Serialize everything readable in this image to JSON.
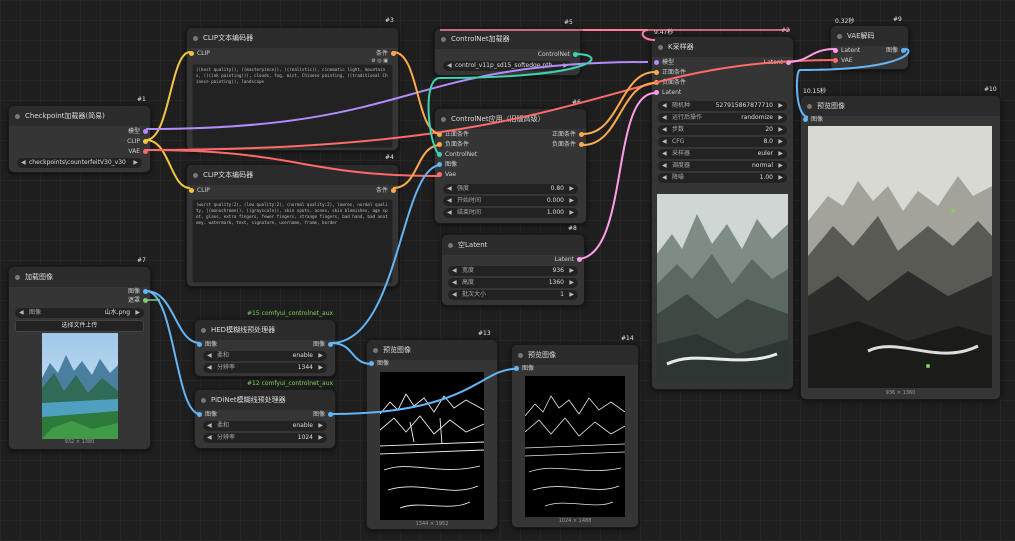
{
  "nodes": {
    "checkpoint": {
      "id": "#1",
      "title": "Checkpoint加载器(简易)",
      "outputs": [
        "模型",
        "CLIP",
        "VAE"
      ],
      "ckpt": "checkpoints\\counterfeitV30_v30"
    },
    "clip_pos": {
      "id": "#3",
      "title": "CLIP文本编码器",
      "input": "CLIP",
      "output": "条件",
      "text": "((best quality)), ((masterpiece)), ((realistic)), cinematic light, mountains, (((ink painting))), clouds, fog, mist, Chinese painting, ((traditional Chinese painting)), landscape"
    },
    "clip_neg": {
      "id": "#4",
      "title": "CLIP文本编码器",
      "input": "CLIP",
      "output": "条件",
      "text": "(worst quality:2), (low quality:2), (normal quality:2), lowres, normal quality, ((monochrome)), ((grayscale)), skin spots, acnes, skin blemishes, age spot, glans, extra fingers, fewer fingers, strange fingers, bad hand, bad anatomy, watermark, text, signature, username, frame, border"
    },
    "cn_loader": {
      "id": "#5",
      "title": "ControlNet加载器",
      "output": "ControlNet",
      "model": "control_v11p_sd15_softedge.pth"
    },
    "cn_apply": {
      "id": "#6",
      "title": "ControlNet应用（旧版高级）",
      "inputs": [
        "正面条件",
        "负面条件",
        "ControlNet",
        "图像",
        "Vae"
      ],
      "outputs": [
        "正面条件",
        "负面条件"
      ],
      "strength_label": "强度",
      "strength": "0.80",
      "start_label": "开始时间",
      "start": "0.000",
      "end_label": "结束时间",
      "end": "1.000"
    },
    "ksampler": {
      "id": "#2",
      "time": "9.47秒",
      "title": "K采样器",
      "inputs": [
        "模型",
        "正面条件",
        "负面条件",
        "Latent"
      ],
      "output": "Latent",
      "seed_label": "随机种",
      "seed": "527915867877710",
      "control_label": "运行后操作",
      "control": "randomize",
      "steps_label": "步数",
      "steps": "20",
      "cfg_label": "CFG",
      "cfg": "8.0",
      "sampler_label": "采样器",
      "sampler": "euler",
      "scheduler_label": "调度器",
      "scheduler": "normal",
      "denoise_label": "降噪",
      "denoise": "1.00"
    },
    "vae_decode": {
      "id": "#9",
      "time": "0.32秒",
      "title": "VAE解码",
      "inputs": [
        "Latent",
        "VAE"
      ],
      "output": "图像"
    },
    "empty_latent": {
      "id": "#8",
      "title": "空Latent",
      "output": "Latent",
      "width_label": "宽度",
      "width": "936",
      "height_label": "高度",
      "height": "1360",
      "batch_label": "批次大小",
      "batch": "1"
    },
    "preview_main": {
      "id": "#10",
      "time": "10.15秒",
      "title": "预览图像",
      "input": "图像",
      "caption": "936 × 1360"
    },
    "load_image": {
      "id": "#7",
      "title": "加载图像",
      "outputs": [
        "图像",
        "遮罩"
      ],
      "image_label": "图像",
      "image": "山水.png",
      "upload": "选择文件上传",
      "caption": "932 × 1380"
    },
    "hed": {
      "id": "#15 comfyui_controlnet_aux",
      "title": "HED模糊线预处理器",
      "input": "图像",
      "output": "图像",
      "w1_label": "柔和",
      "w1": "enable",
      "w2_label": "分辨率",
      "w2": "1344"
    },
    "pidinet": {
      "id": "#12 comfyui_controlnet_aux",
      "title": "PiDiNet模糊线预处理器",
      "input": "图像",
      "output": "图像",
      "w1_label": "柔和",
      "w1": "enable",
      "w2_label": "分辨率",
      "w2": "1024"
    },
    "preview_hed": {
      "id": "#13",
      "title": "预览图像",
      "input": "图像",
      "caption": "1344 × 1952"
    },
    "preview_pidi": {
      "id": "#14",
      "title": "预览图像",
      "input": "图像",
      "caption": "1024 × 1488"
    }
  },
  "colors": {
    "clip": "#f5c542",
    "model": "#b58cff",
    "vae": "#ff6b6b",
    "conditioning": "#ffa94d",
    "latent": "#ff9ee6",
    "image": "#64b5f6",
    "controlnet": "#3fd1b0",
    "mask": "#81c784"
  }
}
